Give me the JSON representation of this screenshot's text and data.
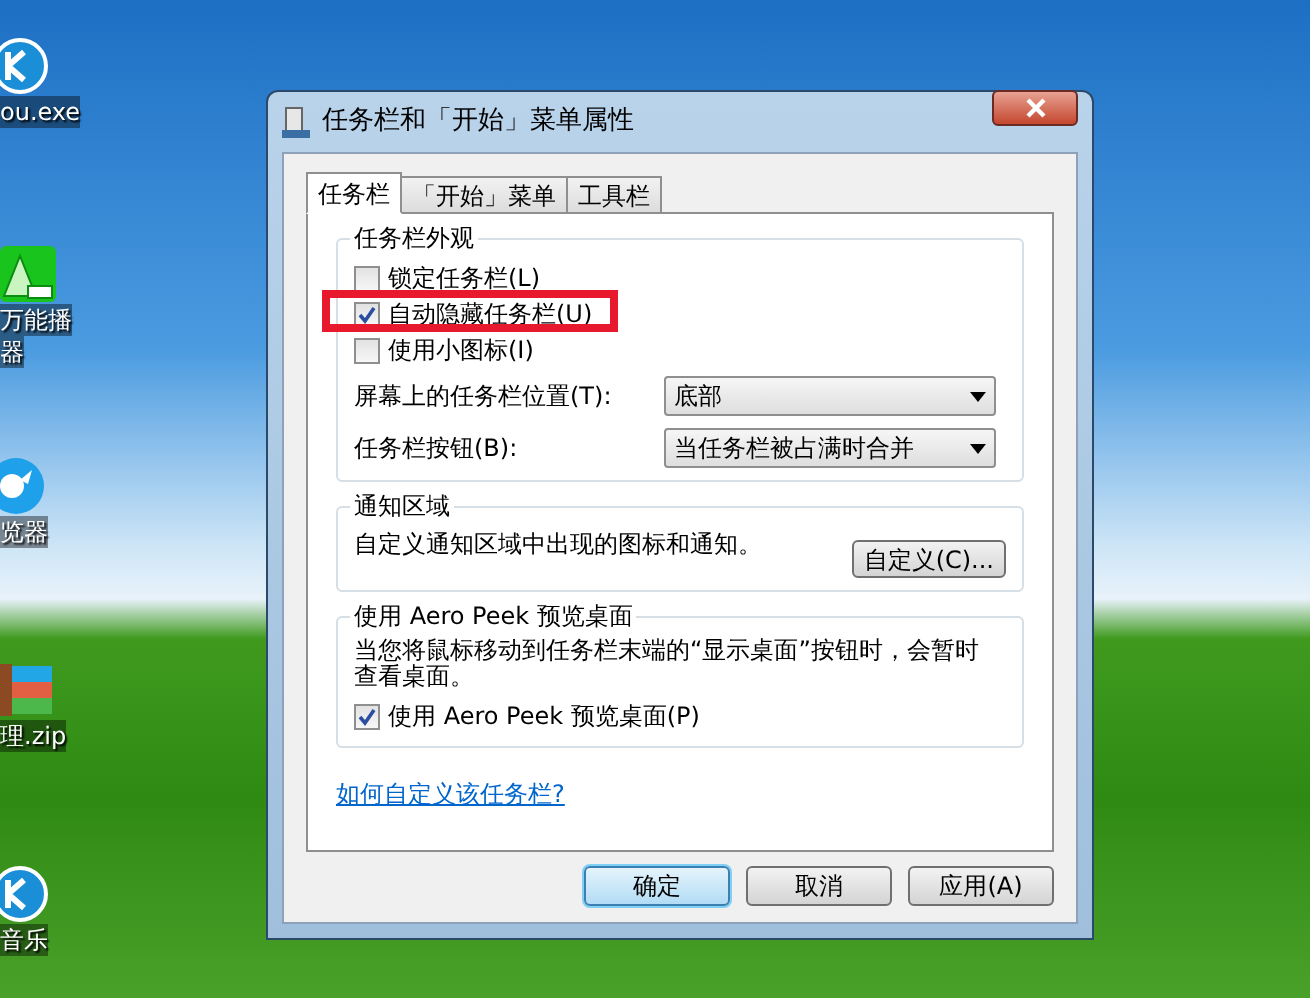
{
  "desktop_icons": [
    {
      "kind": "k-app",
      "lines": [
        "ou.exe"
      ]
    },
    {
      "kind": "video-player",
      "lines": [
        "万能播",
        "器"
      ]
    },
    {
      "kind": "browser",
      "lines": [
        "览器"
      ]
    },
    {
      "kind": "archive",
      "lines": [
        "理.zip"
      ]
    },
    {
      "kind": "k-app",
      "lines": [
        "音乐"
      ]
    }
  ],
  "window": {
    "title": "任务栏和「开始」菜单属性",
    "tabs": [
      {
        "label": "任务栏",
        "selected": true
      },
      {
        "label": "「开始」菜单",
        "selected": false
      },
      {
        "label": "工具栏",
        "selected": false
      }
    ],
    "appearance": {
      "title": "任务栏外观",
      "checkboxes": [
        {
          "label": "锁定任务栏(L)",
          "checked": false,
          "highlighted": false
        },
        {
          "label": "自动隐藏任务栏(U)",
          "checked": true,
          "highlighted": true
        },
        {
          "label": "使用小图标(I)",
          "checked": false,
          "highlighted": false
        }
      ],
      "dropdowns": [
        {
          "label": "屏幕上的任务栏位置(T):",
          "value": "底部"
        },
        {
          "label": "任务栏按钮(B):",
          "value": "当任务栏被占满时合并"
        }
      ]
    },
    "notification_area": {
      "title": "通知区域",
      "text": "自定义通知区域中出现的图标和通知。",
      "button": "自定义(C)..."
    },
    "aero_peek": {
      "title": "使用 Aero Peek 预览桌面",
      "text": "当您将鼠标移动到任务栏末端的“显示桌面”按钮时，会暂时查看桌面。",
      "checkbox": {
        "label": "使用 Aero Peek 预览桌面(P)",
        "checked": true
      }
    },
    "help_link": "如何自定义该任务栏?",
    "buttons": [
      {
        "label": "确定",
        "default": true
      },
      {
        "label": "取消",
        "default": false
      },
      {
        "label": "应用(A)",
        "default": false
      }
    ]
  }
}
